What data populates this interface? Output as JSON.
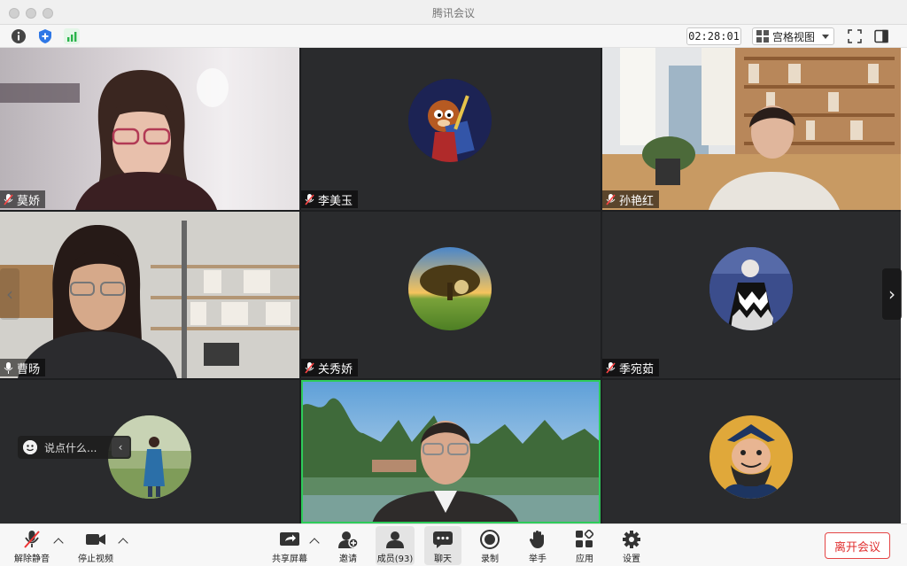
{
  "window": {
    "title": "腾讯会议"
  },
  "toolbar": {
    "timer": "02:28:01",
    "view_mode": "宫格视图",
    "icons": [
      "info-icon",
      "shield-icon",
      "signal-icon",
      "fullscreen-icon",
      "sidebar-icon"
    ]
  },
  "participants": [
    {
      "name": "莫娇",
      "muted": true,
      "type": "video"
    },
    {
      "name": "李美玉",
      "muted": true,
      "type": "avatar"
    },
    {
      "name": "孙艳红",
      "muted": true,
      "type": "video"
    },
    {
      "name": "曹旸",
      "muted": false,
      "type": "video"
    },
    {
      "name": "关秀娇",
      "muted": true,
      "type": "avatar"
    },
    {
      "name": "季宛茹",
      "muted": true,
      "type": "avatar"
    },
    {
      "name": "",
      "muted": false,
      "type": "avatar"
    },
    {
      "name": "",
      "muted": false,
      "type": "video",
      "speaking": true
    },
    {
      "name": "",
      "muted": false,
      "type": "avatar"
    }
  ],
  "chat_popup": {
    "placeholder": "说点什么..."
  },
  "bottom_bar": {
    "unmute": "解除静音",
    "stop_video": "停止视频",
    "share_screen": "共享屏幕",
    "invite": "邀请",
    "members": "成员(93)",
    "chat": "聊天",
    "record": "录制",
    "raise_hand": "举手",
    "apps": "应用",
    "settings": "设置",
    "leave": "离开会议"
  },
  "colors": {
    "leave": "#e02f2f",
    "speaking_border": "#2ecc5a"
  }
}
